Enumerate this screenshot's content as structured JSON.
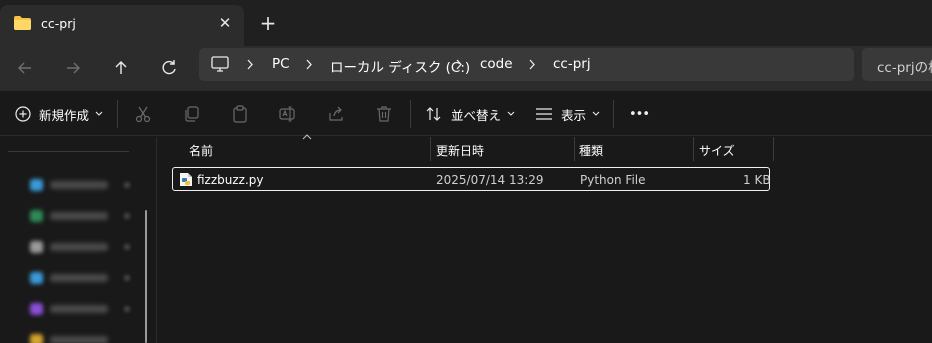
{
  "tab": {
    "title": "cc-prj",
    "close": "✕",
    "new_tab": "+"
  },
  "address": {
    "crumbs": [
      "PC",
      "ローカル ディスク (C:)",
      "code",
      "cc-prj"
    ]
  },
  "search": {
    "placeholder": "cc-prjの検"
  },
  "toolbar": {
    "new_label": "新規作成",
    "sort_label": "並べ替え",
    "view_label": "表示",
    "more": "•••"
  },
  "columns": {
    "name": "名前",
    "modified": "更新日時",
    "type": "種類",
    "size": "サイズ"
  },
  "files": [
    {
      "name": "fizzbuzz.py",
      "modified": "2025/07/14 13:29",
      "type": "Python File",
      "size": "1 KB"
    }
  ],
  "colors": {
    "window_bg": "#191919",
    "tab_bg": "#2c2c2c",
    "address_bg": "#393939",
    "folder": "#f6c445"
  }
}
